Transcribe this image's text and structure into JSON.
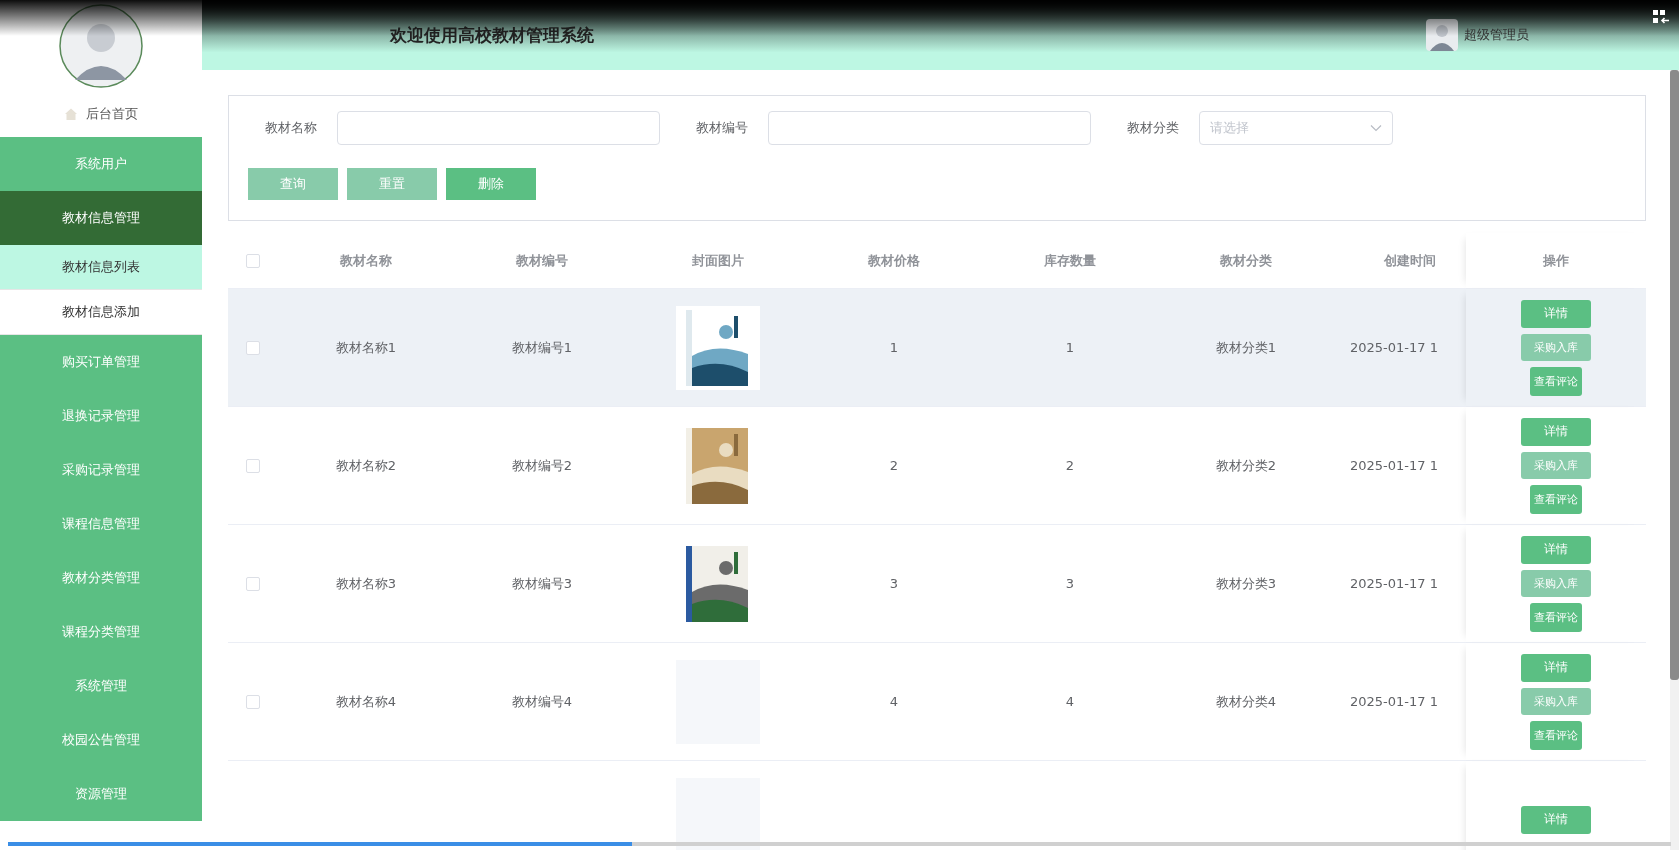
{
  "header": {
    "title": "欢迎使用高校教材管理系统",
    "user": "超级管理员"
  },
  "sidebar": {
    "home": "后台首页",
    "items": [
      {
        "label": "系统用户",
        "expanded": false
      },
      {
        "label": "教材信息管理",
        "expanded": true,
        "children": [
          {
            "label": "教材信息列表",
            "selected": true
          },
          {
            "label": "教材信息添加",
            "selected": false
          }
        ]
      },
      {
        "label": "购买订单管理",
        "expanded": false
      },
      {
        "label": "退换记录管理",
        "expanded": false
      },
      {
        "label": "采购记录管理",
        "expanded": false
      },
      {
        "label": "课程信息管理",
        "expanded": false
      },
      {
        "label": "教材分类管理",
        "expanded": false
      },
      {
        "label": "课程分类管理",
        "expanded": false
      },
      {
        "label": "系统管理",
        "expanded": false
      },
      {
        "label": "校园公告管理",
        "expanded": false
      },
      {
        "label": "资源管理",
        "expanded": false
      }
    ]
  },
  "search": {
    "fields": [
      {
        "label": "教材名称",
        "kind": "input"
      },
      {
        "label": "教材编号",
        "kind": "input"
      },
      {
        "label": "教材分类",
        "kind": "select",
        "placeholder": "请选择"
      }
    ],
    "buttons": [
      {
        "label": "查询",
        "kind": "light"
      },
      {
        "label": "重置",
        "kind": "light"
      },
      {
        "label": "删除",
        "kind": "primary"
      }
    ]
  },
  "table": {
    "select_all_checked": false,
    "columns": [
      "教材名称",
      "教材编号",
      "封面图片",
      "教材价格",
      "库存数量",
      "教材分类",
      "创建时间",
      "操作"
    ],
    "rows": [
      {
        "checked": false,
        "hovered": true,
        "name": "教材名称1",
        "code": "教材编号1",
        "price": "1",
        "stock": "1",
        "category": "教材分类1",
        "created": "2025-01-17 1",
        "actions": [
          {
            "label": "详情",
            "kind": "primary"
          },
          {
            "label": "采购入库",
            "kind": "light"
          },
          {
            "label": "查看评论",
            "kind": "small"
          }
        ]
      },
      {
        "checked": false,
        "hovered": false,
        "name": "教材名称2",
        "code": "教材编号2",
        "price": "2",
        "stock": "2",
        "category": "教材分类2",
        "created": "2025-01-17 1",
        "actions": [
          {
            "label": "详情",
            "kind": "primary"
          },
          {
            "label": "采购入库",
            "kind": "light"
          },
          {
            "label": "查看评论",
            "kind": "small"
          }
        ]
      },
      {
        "checked": false,
        "hovered": false,
        "name": "教材名称3",
        "code": "教材编号3",
        "price": "3",
        "stock": "3",
        "category": "教材分类3",
        "created": "2025-01-17 1",
        "actions": [
          {
            "label": "详情",
            "kind": "primary"
          },
          {
            "label": "采购入库",
            "kind": "light"
          },
          {
            "label": "查看评论",
            "kind": "small"
          }
        ]
      },
      {
        "checked": false,
        "hovered": false,
        "name": "教材名称4",
        "code": "教材编号4",
        "cover": {
          "kind": "empty"
        },
        "price": "4",
        "stock": "4",
        "category": "教材分类4",
        "created": "2025-01-17 1",
        "actions": [
          {
            "label": "详情",
            "kind": "primary"
          },
          {
            "label": "采购入库",
            "kind": "light"
          },
          {
            "label": "查看评论",
            "kind": "small"
          }
        ]
      },
      {
        "cover": {
          "kind": "empty"
        },
        "actions": [
          {
            "label": "详情",
            "kind": "primary"
          }
        ]
      }
    ]
  },
  "player": {
    "level": 0.375
  }
}
